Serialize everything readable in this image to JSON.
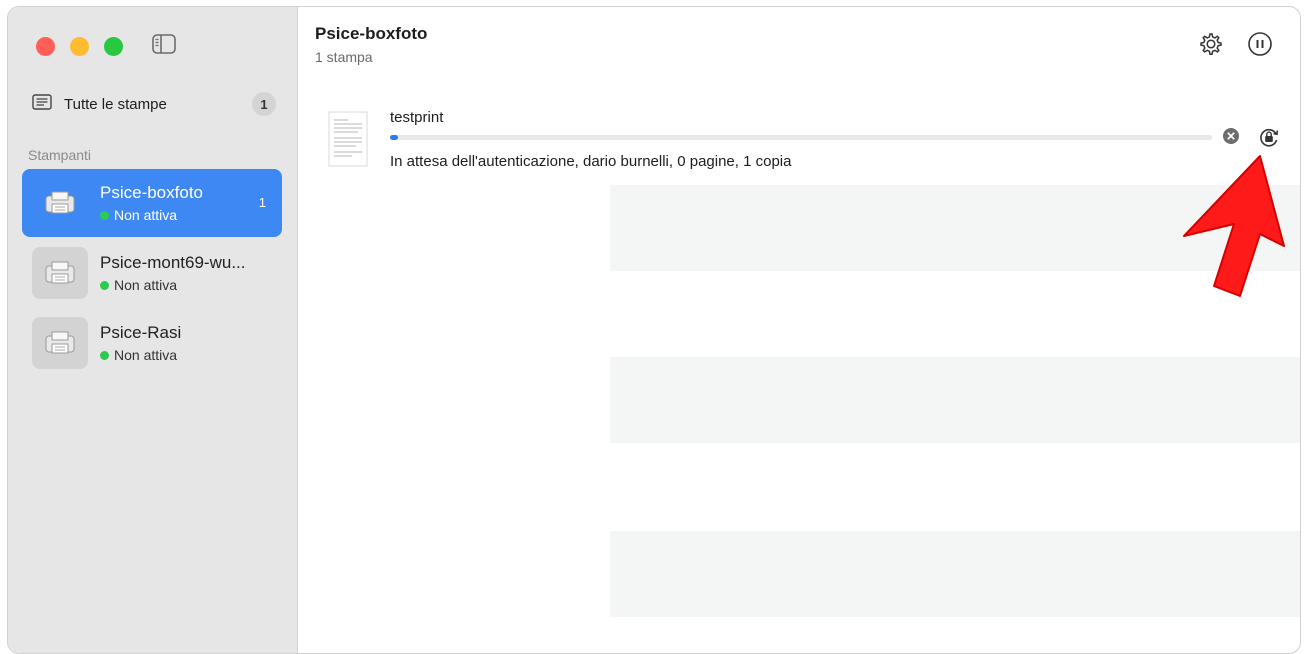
{
  "sidebar": {
    "all_prints": {
      "label": "Tutte le stampe",
      "count": "1"
    },
    "section_label": "Stampanti",
    "printers": [
      {
        "name": "Psice-boxfoto",
        "status": "Non attiva",
        "count": "1"
      },
      {
        "name": "Psice-mont69-wu...",
        "status": "Non attiva"
      },
      {
        "name": "Psice-Rasi",
        "status": "Non attiva"
      }
    ]
  },
  "main": {
    "title": "Psice-boxfoto",
    "subtitle": "1 stampa",
    "job": {
      "name": "testprint",
      "progress_percent": 1,
      "status": "In attesa dell'autenticazione, dario burnelli, 0 pagine, 1 copia"
    }
  },
  "icons": {
    "sidebar_toggle": "sidebar-toggle-icon",
    "all_prints": "list-icon",
    "printer": "printer-icon",
    "settings": "gear-icon",
    "pause": "pause-icon",
    "cancel": "close-circle-icon",
    "resume": "lock-resume-icon",
    "annotation": "red-arrow-icon"
  },
  "colors": {
    "accent": "#3e88f3",
    "status_active": "#2ec94f",
    "annotation": "#ff1a1a"
  }
}
